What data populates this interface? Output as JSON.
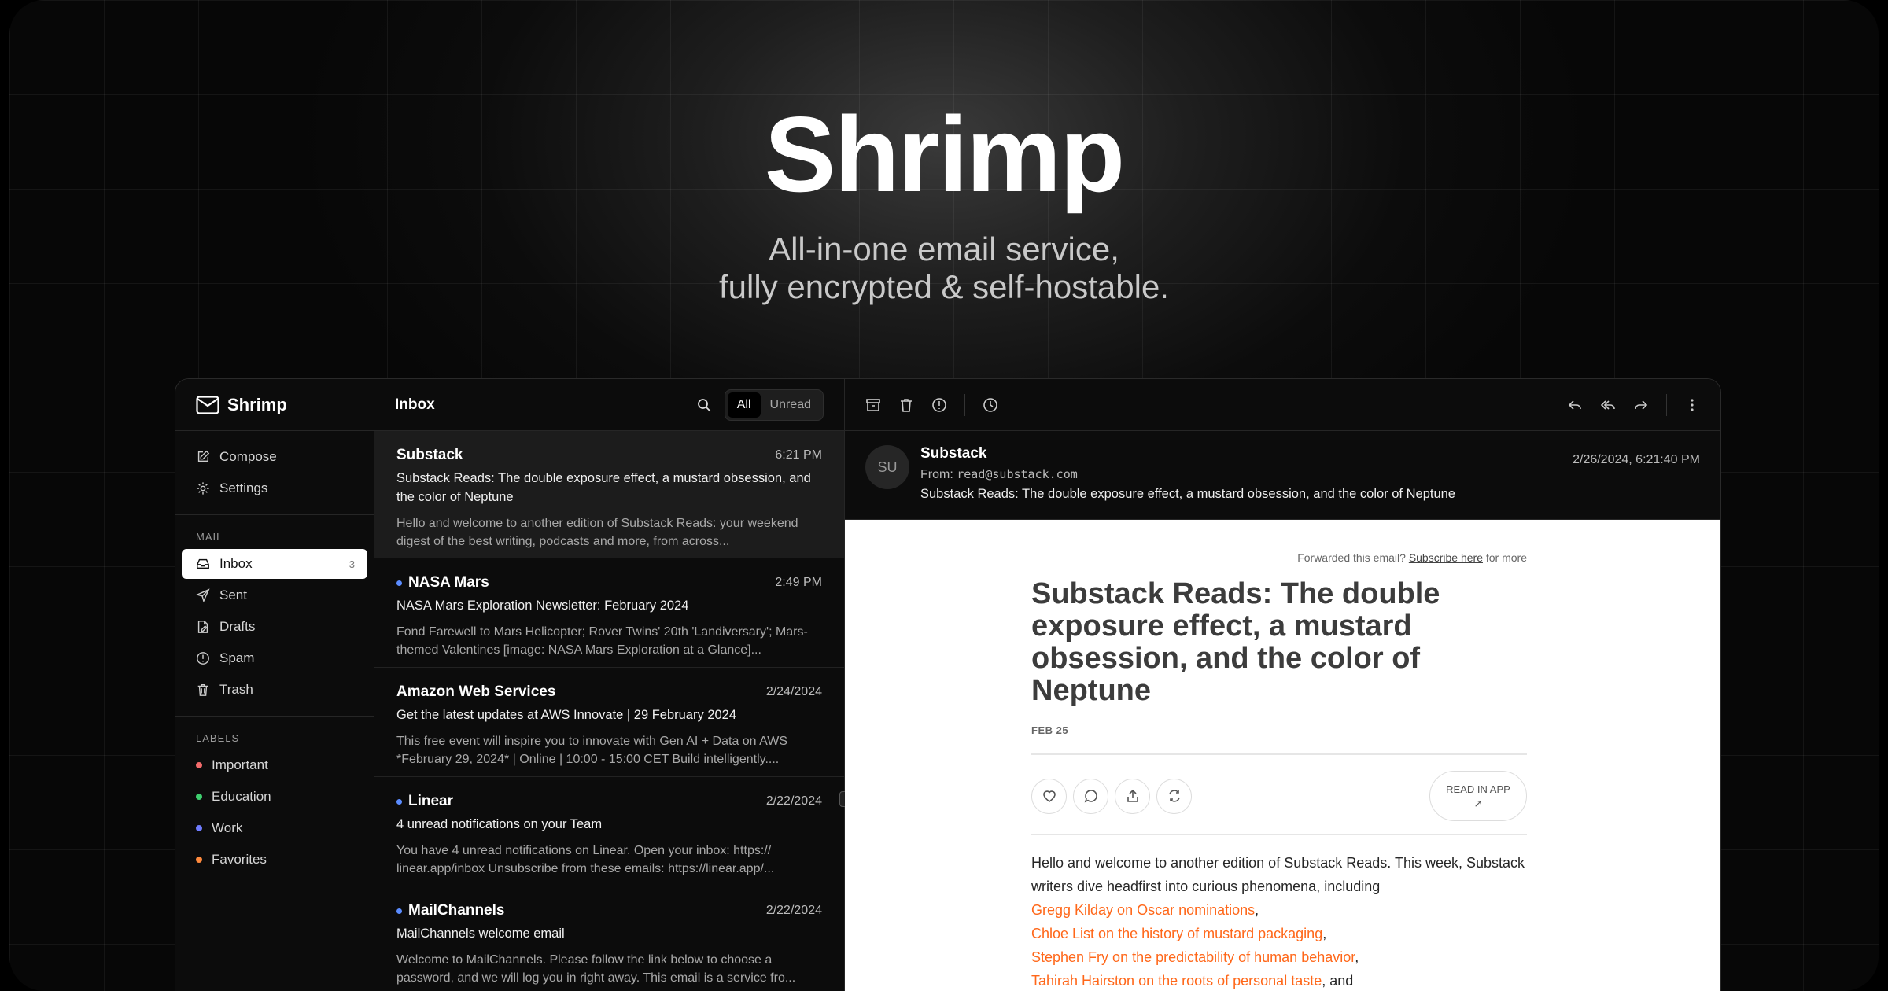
{
  "hero": {
    "title": "Shrimp",
    "subtitle_line1": "All-in-one email service,",
    "subtitle_line2": "fully encrypted & self-hostable."
  },
  "sidebar": {
    "brand": "Shrimp",
    "actions": [
      {
        "label": "Compose",
        "icon": "compose-icon"
      },
      {
        "label": "Settings",
        "icon": "gear-icon"
      }
    ],
    "mail_heading": "MAIL",
    "folders": [
      {
        "label": "Inbox",
        "count": "3",
        "icon": "inbox-icon",
        "active": true
      },
      {
        "label": "Sent",
        "icon": "send-icon"
      },
      {
        "label": "Drafts",
        "icon": "drafts-icon"
      },
      {
        "label": "Spam",
        "icon": "spam-icon"
      },
      {
        "label": "Trash",
        "icon": "trash-icon"
      }
    ],
    "labels_heading": "LABELS",
    "labels": [
      {
        "label": "Important",
        "color": "#f26b6b"
      },
      {
        "label": "Education",
        "color": "#3ecf6e"
      },
      {
        "label": "Work",
        "color": "#6f7cff"
      },
      {
        "label": "Favorites",
        "color": "#ff8a3d"
      }
    ]
  },
  "list": {
    "title": "Inbox",
    "filter_all": "All",
    "filter_unread": "Unread",
    "emails": [
      {
        "sender": "Substack",
        "time": "6:21 PM",
        "unread": false,
        "selected": true,
        "subject": "Substack Reads: The double exposure effect, a mustard obsession, and the color of Neptune",
        "preview": "Hello and welcome to another edition of Substack Reads: your weekend digest of the best writing, podcasts and more, from across..."
      },
      {
        "sender": "NASA Mars",
        "time": "2:49 PM",
        "unread": true,
        "selected": false,
        "subject": "NASA Mars Exploration Newsletter: February 2024",
        "preview": "Fond Farewell to Mars Helicopter; Rover Twins' 20th 'Landiversary'; Mars-themed Valentines [image: NASA Mars Exploration at a Glance]..."
      },
      {
        "sender": "Amazon Web Services",
        "time": "2/24/2024",
        "unread": false,
        "selected": false,
        "subject": "Get the latest updates at AWS Innovate | 29 February 2024",
        "preview": "This free event will inspire you to innovate with Gen AI + Data on AWS *February 29, 2024* | Online | 10:00 - 15:00 CET Build intelligently...."
      },
      {
        "sender": "Linear",
        "time": "2/22/2024",
        "unread": true,
        "selected": false,
        "subject": "4 unread notifications on your Team",
        "preview": "You have 4 unread notifications on Linear. Open your inbox: https:// linear.app/inbox Unsubscribe from these emails: https://linear.app/..."
      },
      {
        "sender": "MailChannels",
        "time": "2/22/2024",
        "unread": true,
        "selected": false,
        "subject": "MailChannels welcome email",
        "preview": "Welcome to MailChannels. Please follow the link below to choose a password, and we will log you in right away. This email is a service fro..."
      }
    ]
  },
  "reader": {
    "avatar": "SU",
    "sender": "Substack",
    "from_label": "From:",
    "from_address": "read@substack.com",
    "subject": "Substack Reads: The double exposure effect, a mustard obsession, and the color of Neptune",
    "date": "2/26/2024, 6:21:40 PM"
  },
  "email": {
    "forwarded_prefix": "Forwarded this email?",
    "subscribe_link": "Subscribe here",
    "forwarded_suffix": "for more",
    "title": "Substack Reads: The double exposure effect, a mustard obsession, and the color of Neptune",
    "date": "FEB 25",
    "read_in_app": "READ IN APP",
    "intro": "Hello and welcome to another edition of Substack Reads. This week, Substack writers dive headfirst into curious phenomena, including",
    "links": [
      {
        "text": "Gregg Kilday on Oscar nominations",
        "after": ","
      },
      {
        "text": "Chloe List on the history of mustard packaging",
        "after": ","
      },
      {
        "text": "Stephen Fry on the predictability of human behavior",
        "after": ","
      },
      {
        "text": "Tahirah Hairston on the roots of personal taste",
        "after": ", and"
      }
    ],
    "link_color": "#ff6719"
  }
}
